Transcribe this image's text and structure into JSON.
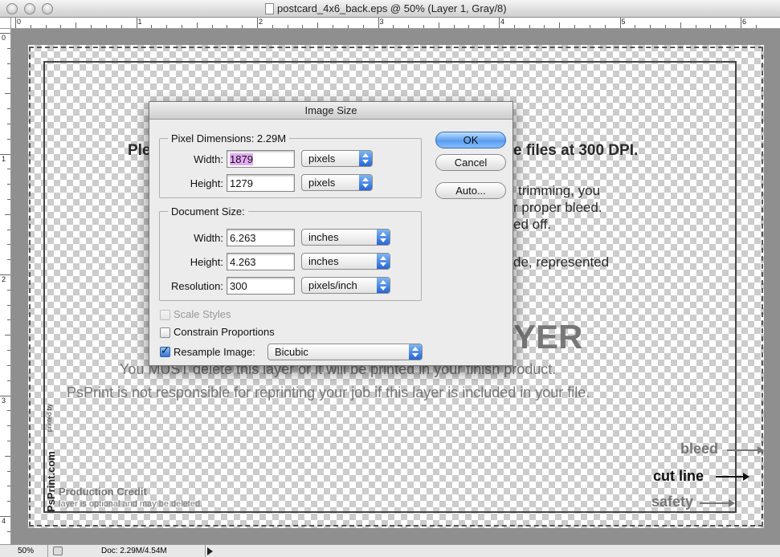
{
  "window": {
    "title": "postcard_4x6_back.eps @ 50% (Layer 1, Gray/8)"
  },
  "rulers": {
    "top_numbers": [
      "0",
      "1",
      "2",
      "3",
      "4",
      "5",
      "6"
    ],
    "left_numbers": [
      "0",
      "1",
      "2",
      "3",
      "4"
    ]
  },
  "artwork": {
    "line1_left": "Ple",
    "line1_right": "e files at 300 DPI.",
    "para_r1": "trimming, you",
    "para_r2": "r proper bleed.",
    "para_r3": "ed off.",
    "para_r4": "de, represented",
    "layer_heading": "YER",
    "warning_line": "You MUST delete this layer or it will be printed in your finish product.",
    "disclaimer_line": "PsPrint is not responsible for reprinting your job if this layer is included in your file.",
    "printed_by_small": "printed by",
    "printed_by_brand": "PsPrint.com",
    "production_credit": "Production Credit",
    "production_note": "layer is optional and may be deleted.",
    "bleed_label": "bleed",
    "cut_line_label": "cut line",
    "safety_label": "safety"
  },
  "status": {
    "zoom": "50%",
    "doc_info": "Doc: 2.29M/4.54M"
  },
  "dialog": {
    "title": "Image Size",
    "pixel_dimensions_label": "Pixel Dimensions:  2.29M",
    "px_width_label": "Width:",
    "px_width_value": "1879",
    "px_width_unit": "pixels",
    "px_height_label": "Height:",
    "px_height_value": "1279",
    "px_height_unit": "pixels",
    "document_size_label": "Document Size:",
    "doc_width_label": "Width:",
    "doc_width_value": "6.263",
    "doc_width_unit": "inches",
    "doc_height_label": "Height:",
    "doc_height_value": "4.263",
    "doc_height_unit": "inches",
    "resolution_label": "Resolution:",
    "resolution_value": "300",
    "resolution_unit": "pixels/inch",
    "scale_styles_label": "Scale Styles",
    "constrain_label": "Constrain Proportions",
    "resample_label": "Resample Image:",
    "resample_value": "Bicubic",
    "ok_label": "OK",
    "cancel_label": "Cancel",
    "auto_label": "Auto..."
  }
}
